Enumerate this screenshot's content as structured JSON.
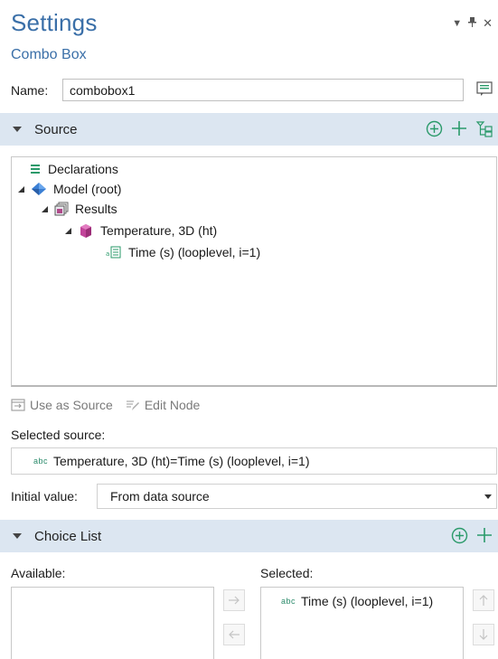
{
  "header": {
    "title": "Settings",
    "subtitle": "Combo Box"
  },
  "name_field": {
    "label": "Name:",
    "value": "combobox1"
  },
  "source_section": {
    "title": "Source"
  },
  "tree": {
    "items": [
      {
        "label": "Declarations",
        "icon": "declarations-icon"
      },
      {
        "label": "Model (root)",
        "icon": "model-icon"
      },
      {
        "label": "Results",
        "icon": "results-icon"
      },
      {
        "label": "Temperature, 3D (ht)",
        "icon": "dataset-3d-icon"
      },
      {
        "label": "Time (s) (looplevel, i=1)",
        "icon": "parameter-icon"
      }
    ]
  },
  "actions": {
    "use_as_source": "Use as Source",
    "edit_node": "Edit Node"
  },
  "selected_source": {
    "label": "Selected source:",
    "abc": "abc",
    "value": "Temperature, 3D (ht)=Time (s) (looplevel, i=1)"
  },
  "initial_value": {
    "label": "Initial value:",
    "value": "From data source"
  },
  "choice_list": {
    "title": "Choice List",
    "available_label": "Available:",
    "selected_label": "Selected:",
    "selected_items": [
      {
        "abc": "abc",
        "label": "Time (s) (looplevel, i=1)"
      }
    ]
  },
  "colors": {
    "accent": "#3a6fa8",
    "section_bg": "#dce6f1",
    "icon_green": "#2a9a6a"
  }
}
